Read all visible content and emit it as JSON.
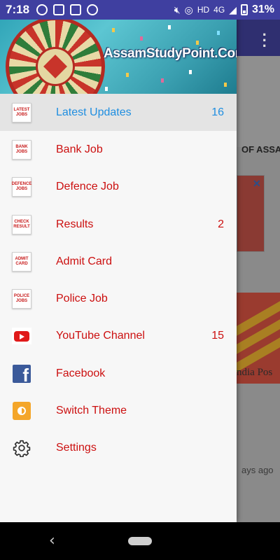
{
  "status_bar": {
    "time": "7:18",
    "network": "HD",
    "signal": "4G",
    "battery": "31%"
  },
  "background_app": {
    "emblem_caption": "OF ASSAM",
    "card_caption": "ndia Pos",
    "timestamp": "ays ago"
  },
  "drawer": {
    "brand": "AssamStudyPoint.Com",
    "items": [
      {
        "label": "Latest Updates",
        "count": "16",
        "icon": "latest-jobs-icon",
        "icon_lines": [
          "LATEST",
          "JOBS"
        ],
        "active": true
      },
      {
        "label": "Bank Job",
        "count": "",
        "icon": "bank-jobs-icon",
        "icon_lines": [
          "BANK",
          "JOBS"
        ]
      },
      {
        "label": "Defence Job",
        "count": "",
        "icon": "defence-jobs-icon",
        "icon_lines": [
          "DEFENCE",
          "JOBS"
        ]
      },
      {
        "label": "Results",
        "count": "2",
        "icon": "check-result-icon",
        "icon_lines": [
          "CHECK",
          "RESULT"
        ]
      },
      {
        "label": "Admit Card",
        "count": "",
        "icon": "admit-card-icon",
        "icon_lines": [
          "ADMIT",
          "CARD"
        ]
      },
      {
        "label": "Police Job",
        "count": "",
        "icon": "police-jobs-icon",
        "icon_lines": [
          "POLICE",
          "JOBS"
        ]
      },
      {
        "label": "YouTube Channel",
        "count": "15",
        "icon": "youtube-icon"
      },
      {
        "label": "Facebook",
        "count": "",
        "icon": "facebook-icon"
      },
      {
        "label": "Switch Theme",
        "count": "",
        "icon": "theme-icon"
      },
      {
        "label": "Settings",
        "count": "",
        "icon": "gear-icon"
      }
    ]
  },
  "colors": {
    "active": "#1f8ee0",
    "item_text": "#cc1010",
    "status_bar": "#3f3fa0"
  }
}
